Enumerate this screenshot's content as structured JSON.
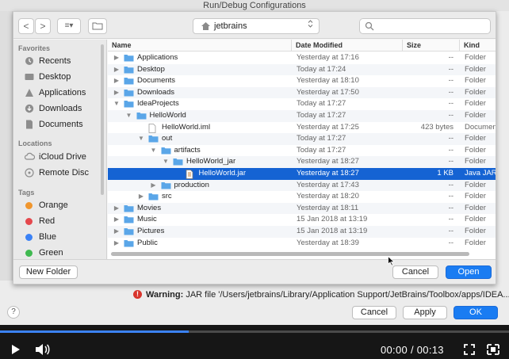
{
  "window": {
    "title": "Run/Debug Configurations"
  },
  "toolbar": {
    "back_glyph": "<",
    "forward_glyph": ">",
    "view_glyph": "≡▾",
    "location": "jetbrains",
    "search_placeholder": ""
  },
  "sidebar": {
    "favorites_label": "Favorites",
    "favorites": [
      {
        "label": "Recents",
        "icon": "clock-icon"
      },
      {
        "label": "Desktop",
        "icon": "desktop-icon"
      },
      {
        "label": "Applications",
        "icon": "applications-icon"
      },
      {
        "label": "Downloads",
        "icon": "downloads-icon"
      },
      {
        "label": "Documents",
        "icon": "documents-icon"
      }
    ],
    "locations_label": "Locations",
    "locations": [
      {
        "label": "iCloud Drive",
        "icon": "cloud-icon"
      },
      {
        "label": "Remote Disc",
        "icon": "disc-icon"
      }
    ],
    "tags_label": "Tags",
    "tags": [
      {
        "label": "Orange",
        "color": "#f0962e"
      },
      {
        "label": "Red",
        "color": "#e5484d"
      },
      {
        "label": "Blue",
        "color": "#3b82f6"
      },
      {
        "label": "Green",
        "color": "#3fb950"
      }
    ]
  },
  "list": {
    "columns": {
      "name": "Name",
      "date": "Date Modified",
      "size": "Size",
      "kind": "Kind"
    },
    "rows": [
      {
        "name": "Applications",
        "date": "Yesterday at 17:16",
        "size": "--",
        "kind": "Folder",
        "level": 0,
        "expander": "▶",
        "type": "folder",
        "selected": false
      },
      {
        "name": "Desktop",
        "date": "Today at 17:24",
        "size": "--",
        "kind": "Folder",
        "level": 0,
        "expander": "▶",
        "type": "folder",
        "selected": false
      },
      {
        "name": "Documents",
        "date": "Yesterday at 18:10",
        "size": "--",
        "kind": "Folder",
        "level": 0,
        "expander": "▶",
        "type": "folder",
        "selected": false
      },
      {
        "name": "Downloads",
        "date": "Yesterday at 17:50",
        "size": "--",
        "kind": "Folder",
        "level": 0,
        "expander": "▶",
        "type": "folder",
        "selected": false
      },
      {
        "name": "IdeaProjects",
        "date": "Today at 17:27",
        "size": "--",
        "kind": "Folder",
        "level": 0,
        "expander": "▼",
        "type": "folder",
        "selected": false
      },
      {
        "name": "HelloWorld",
        "date": "Today at 17:27",
        "size": "--",
        "kind": "Folder",
        "level": 1,
        "expander": "▼",
        "type": "folder",
        "selected": false
      },
      {
        "name": "HelloWorld.iml",
        "date": "Yesterday at 17:25",
        "size": "423 bytes",
        "kind": "Document",
        "level": 2,
        "expander": "",
        "type": "file",
        "selected": false
      },
      {
        "name": "out",
        "date": "Today at 17:27",
        "size": "--",
        "kind": "Folder",
        "level": 2,
        "expander": "▼",
        "type": "folder",
        "selected": false
      },
      {
        "name": "artifacts",
        "date": "Today at 17:27",
        "size": "--",
        "kind": "Folder",
        "level": 3,
        "expander": "▼",
        "type": "folder",
        "selected": false
      },
      {
        "name": "HelloWorld_jar",
        "date": "Yesterday at 18:27",
        "size": "--",
        "kind": "Folder",
        "level": 4,
        "expander": "▼",
        "type": "folder",
        "selected": false
      },
      {
        "name": "HelloWorld.jar",
        "date": "Yesterday at 18:27",
        "size": "1 KB",
        "kind": "Java JAR",
        "level": 5,
        "expander": "",
        "type": "jar",
        "selected": true
      },
      {
        "name": "production",
        "date": "Yesterday at 17:43",
        "size": "--",
        "kind": "Folder",
        "level": 3,
        "expander": "▶",
        "type": "folder",
        "selected": false
      },
      {
        "name": "src",
        "date": "Yesterday at 18:20",
        "size": "--",
        "kind": "Folder",
        "level": 2,
        "expander": "▶",
        "type": "folder",
        "selected": false
      },
      {
        "name": "Movies",
        "date": "Yesterday at 18:11",
        "size": "--",
        "kind": "Folder",
        "level": 0,
        "expander": "▶",
        "type": "folder",
        "selected": false
      },
      {
        "name": "Music",
        "date": "15 Jan 2018 at 13:19",
        "size": "--",
        "kind": "Folder",
        "level": 0,
        "expander": "▶",
        "type": "folder",
        "selected": false
      },
      {
        "name": "Pictures",
        "date": "15 Jan 2018 at 13:19",
        "size": "--",
        "kind": "Folder",
        "level": 0,
        "expander": "▶",
        "type": "folder",
        "selected": false
      },
      {
        "name": "Public",
        "date": "Yesterday at 18:39",
        "size": "--",
        "kind": "Folder",
        "level": 0,
        "expander": "▶",
        "type": "folder",
        "selected": false
      }
    ]
  },
  "dialog_footer": {
    "new_folder": "New Folder",
    "cancel": "Cancel",
    "open": "Open"
  },
  "warning": {
    "label": "Warning:",
    "text": "JAR file '/Users/jetbrains/Library/Application Support/JetBrains/Toolbox/apps/IDEA...",
    "icon_glyph": "!"
  },
  "footer": {
    "help": "?",
    "cancel": "Cancel",
    "apply": "Apply",
    "ok": "OK"
  },
  "video": {
    "time": "00:00 / 00:13",
    "progress": 0.37
  },
  "colors": {
    "selection": "#1563d3",
    "accent": "#1a7cf2",
    "folder": "#5aa6e8"
  }
}
